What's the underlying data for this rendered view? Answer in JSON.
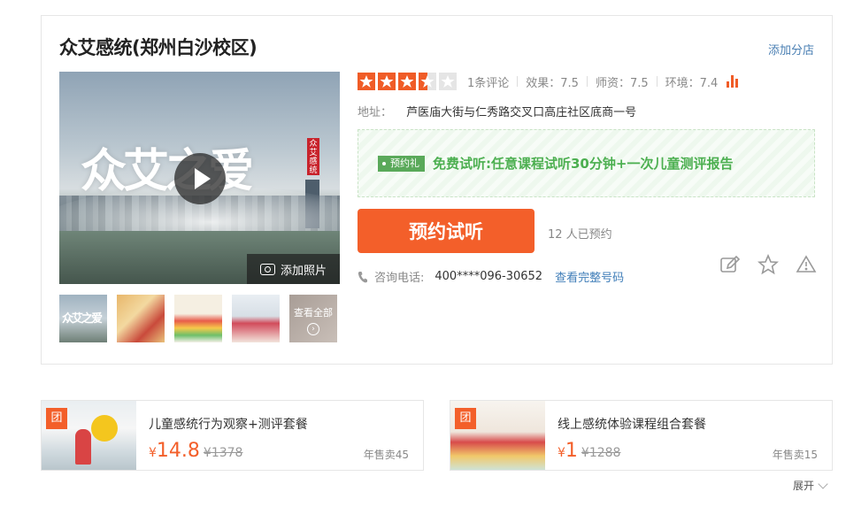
{
  "shop": {
    "name": "众艾感统(郑州白沙校区)",
    "add_branch": "添加分店"
  },
  "media": {
    "video_title_art": "众艾之爱",
    "video_seal": "众艾感统",
    "add_photo": "添加照片",
    "thumbs": [
      {
        "icon": "photo-thumb",
        "label": "众艾之爱"
      },
      {
        "icon": "photo-thumb",
        "label": ""
      },
      {
        "icon": "photo-thumb",
        "label": ""
      },
      {
        "icon": "photo-thumb",
        "label": ""
      }
    ],
    "view_all": "查看全部"
  },
  "rating": {
    "stars": 3.5,
    "reviews": "1条评论",
    "effect": "效果：7.5",
    "teachers": "师资：7.5",
    "environment": "环境：7.4"
  },
  "address": {
    "label": "地址：",
    "value": "芦医庙大街与仁秀路交叉口高庄社区底商一号"
  },
  "promo": {
    "tag": "预约礼",
    "text": "免费试听:任意课程试听30分钟+一次儿童测评报告"
  },
  "booking": {
    "button": "预约试听",
    "count": "12 人已预约"
  },
  "contact": {
    "label": "咨询电话:",
    "number": "400****096-30652",
    "view_full": "查看完整号码"
  },
  "deals": [
    {
      "badge": "团",
      "name": "儿童感统行为观察+测评套餐",
      "currency": "¥",
      "price": "14.8",
      "original": "¥1378",
      "sold": "年售卖45"
    },
    {
      "badge": "团",
      "name": "线上感统体验课程组合套餐",
      "currency": "¥",
      "price": "1",
      "original": "¥1288",
      "sold": "年售卖15"
    }
  ],
  "expand": "展开",
  "colors": {
    "accent": "#f35f2a",
    "link": "#3f7db8",
    "promo_green": "#4caf50"
  }
}
